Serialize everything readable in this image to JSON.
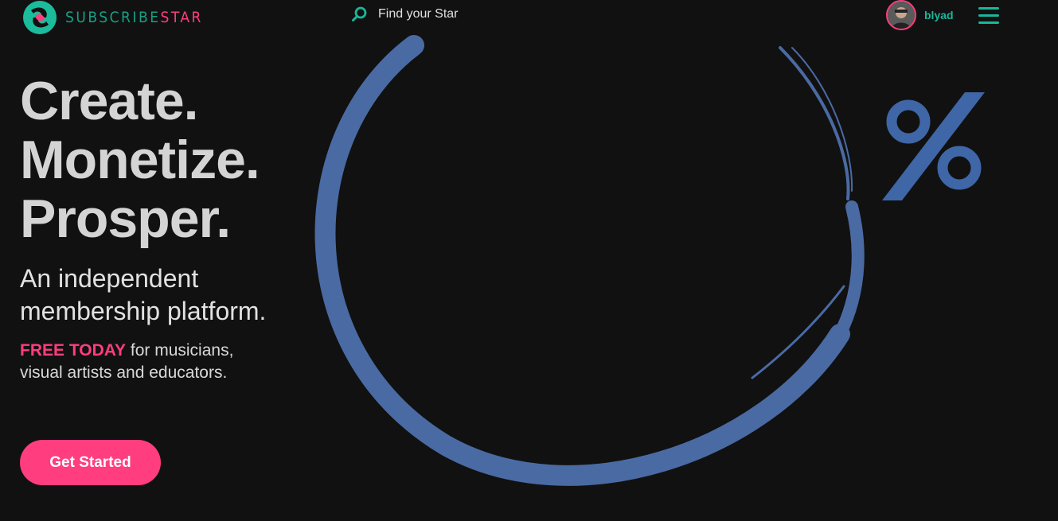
{
  "header": {
    "logo_part1": "SUBSCRIBE",
    "logo_part2": "STAR",
    "search_label": "Find your Star",
    "username": "blyad"
  },
  "hero": {
    "headline": [
      "Create.",
      "Monetize.",
      "Prosper."
    ],
    "subheadline_line1": "An independent",
    "subheadline_line2": "membership platform.",
    "free_highlight": "FREE TODAY",
    "free_rest": " for musicians, visual artists and educators.",
    "cta_label": "Get Started"
  },
  "colors": {
    "background": "#111111",
    "accent_pink": "#ff3d7f",
    "accent_teal": "#18b79a",
    "art_blue": "#4a6aa3"
  },
  "icons": [
    "subscribestar-logo",
    "search-icon",
    "menu-icon"
  ]
}
